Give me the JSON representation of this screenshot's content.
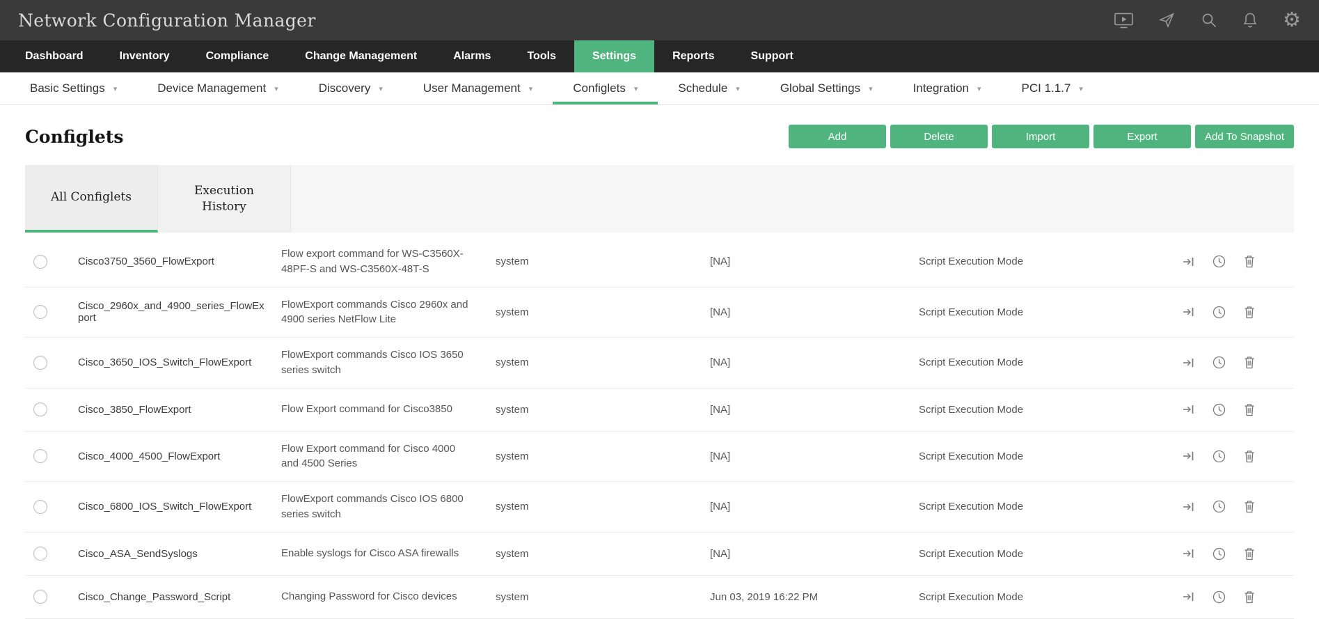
{
  "accent_color": "#50b47f",
  "header": {
    "title": "Network Configuration Manager",
    "icons": [
      "screen-share-icon",
      "send-plane-icon",
      "search-icon",
      "notification-bell-icon",
      "settings-gear-icon"
    ]
  },
  "nav": {
    "items": [
      "Dashboard",
      "Inventory",
      "Compliance",
      "Change Management",
      "Alarms",
      "Tools",
      "Settings",
      "Reports",
      "Support"
    ],
    "active": "Settings"
  },
  "subnav": {
    "items": [
      "Basic Settings",
      "Device Management",
      "Discovery",
      "User Management",
      "Configlets",
      "Schedule",
      "Global Settings",
      "Integration",
      "PCI 1.1.7"
    ],
    "active": "Configlets"
  },
  "page": {
    "title": "Configlets",
    "actions": [
      "Add",
      "Delete",
      "Import",
      "Export",
      "Add To Snapshot"
    ]
  },
  "tabs": [
    {
      "label": "All Configlets",
      "active": true
    },
    {
      "label": "Execution History",
      "active": false
    }
  ],
  "table": {
    "row_action_icons": [
      "execute-icon",
      "history-clock-icon",
      "delete-trash-icon"
    ],
    "rows": [
      {
        "name": "Cisco3750_3560_FlowExport",
        "description": "Flow export command for WS-C3560X-48PF-S and WS-C3560X-48T-S",
        "created_by": "system",
        "last_modified": "[NA]",
        "mode": "Script Execution Mode"
      },
      {
        "name": "Cisco_2960x_and_4900_series_FlowExport",
        "description": "FlowExport commands Cisco 2960x and 4900 series NetFlow Lite",
        "created_by": "system",
        "last_modified": "[NA]",
        "mode": "Script Execution Mode"
      },
      {
        "name": "Cisco_3650_IOS_Switch_FlowExport",
        "description": "FlowExport commands Cisco IOS 3650 series switch",
        "created_by": "system",
        "last_modified": "[NA]",
        "mode": "Script Execution Mode"
      },
      {
        "name": "Cisco_3850_FlowExport",
        "description": "Flow Export command for Cisco3850",
        "created_by": "system",
        "last_modified": "[NA]",
        "mode": "Script Execution Mode"
      },
      {
        "name": "Cisco_4000_4500_FlowExport",
        "description": "Flow Export command for Cisco 4000 and 4500 Series",
        "created_by": "system",
        "last_modified": "[NA]",
        "mode": "Script Execution Mode"
      },
      {
        "name": "Cisco_6800_IOS_Switch_FlowExport",
        "description": "FlowExport commands Cisco IOS 6800 series switch",
        "created_by": "system",
        "last_modified": "[NA]",
        "mode": "Script Execution Mode"
      },
      {
        "name": "Cisco_ASA_SendSyslogs",
        "description": "Enable syslogs for Cisco ASA firewalls",
        "created_by": "system",
        "last_modified": "[NA]",
        "mode": "Script Execution Mode"
      },
      {
        "name": "Cisco_Change_Password_Script",
        "description": "Changing Password for Cisco devices",
        "created_by": "system",
        "last_modified": "Jun 03, 2019 16:22 PM",
        "mode": "Script Execution Mode"
      }
    ]
  }
}
